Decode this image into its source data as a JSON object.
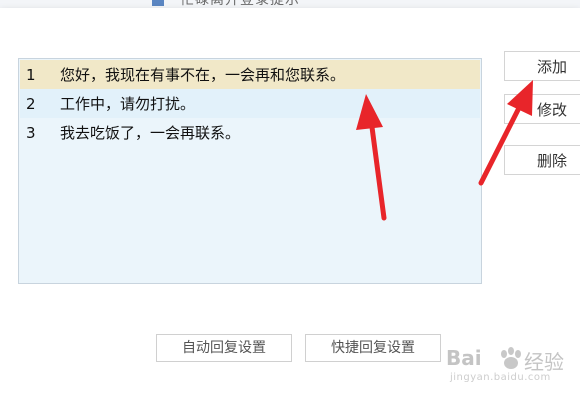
{
  "window": {
    "title": "忙碌离开登录提示"
  },
  "list": {
    "rows": [
      {
        "index": "1",
        "text": "您好，我现在有事不在，一会再和您联系。"
      },
      {
        "index": "2",
        "text": "工作中，请勿打扰。"
      },
      {
        "index": "3",
        "text": "我去吃饭了，一会再联系。"
      }
    ]
  },
  "buttons": {
    "add": "添加",
    "edit": "修改",
    "delete": "删除"
  },
  "bottom": {
    "auto_reply": "自动回复设置",
    "quick_reply": "快捷回复设置"
  },
  "watermark": {
    "brand": "Bai",
    "suffix": "经验",
    "url": "jingyan.baidu.com"
  },
  "colors": {
    "selected_row": "#f1e8c8",
    "list_bg": "#ebf5fb",
    "arrow": "#e8252a"
  }
}
